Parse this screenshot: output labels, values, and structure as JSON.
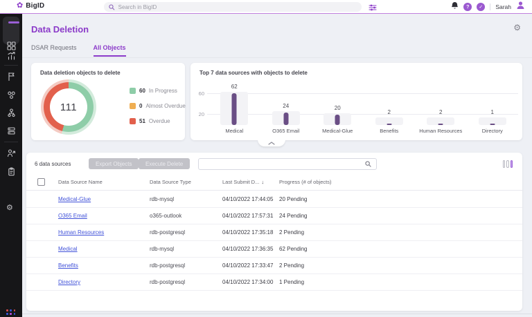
{
  "header": {
    "brand": "BigID",
    "search_placeholder": "Search in BigID",
    "user_name": "Sarah"
  },
  "icons": {
    "logo_flower": "✿",
    "gear": "⚙",
    "help": "?",
    "check": "✓",
    "sort_desc": "↓"
  },
  "page": {
    "title": "Data Deletion",
    "tabs": [
      {
        "label": "DSAR Requests",
        "active": false
      },
      {
        "label": "All Objects",
        "active": true
      }
    ]
  },
  "chart_data": [
    {
      "type": "pie",
      "title": "Data deletion objects to delete",
      "center_total": "111",
      "segments": [
        {
          "label": "In Progress",
          "value": 60,
          "color": "#8ecda8",
          "color_light": "#d3ebdc"
        },
        {
          "label": "Almost Overdue",
          "value": 0,
          "color": "#efae52",
          "color_light": "#f8e0b8"
        },
        {
          "label": "Overdue",
          "value": 51,
          "color": "#e2604c",
          "color_light": "#f4cbc3"
        }
      ],
      "legend_position": "right"
    },
    {
      "type": "bar",
      "title": "Top 7 data sources with objects to delete",
      "categories": [
        "Medical",
        "O365 Email",
        "Medical-Glue",
        "Benefits",
        "Human Resources",
        "Directory"
      ],
      "values": [
        62,
        24,
        20,
        2,
        2,
        1
      ],
      "yticks": [
        "60",
        "20"
      ],
      "ylim": [
        0,
        68
      ],
      "bar_color": "#6a4e85",
      "grid": true,
      "xlabel": "",
      "ylabel": ""
    }
  ],
  "toolbar": {
    "count_label": "6 data sources",
    "export_label": "Export Objects",
    "execute_label": "Execute Delete",
    "search_value": ""
  },
  "table": {
    "columns": [
      "Data Source Name",
      "Data Source Type",
      "Last Submit D...",
      "Progress (# of objects)"
    ],
    "sorted_column": "Last Submit D...",
    "sort_direction": "desc",
    "rows": [
      {
        "name": "Medical-Glue",
        "type": "rdb-mysql",
        "last_submit": "04/10/2022 17:44:05",
        "progress": "20 Pending"
      },
      {
        "name": "O365 Email",
        "type": "o365-outlook",
        "last_submit": "04/10/2022 17:57:31",
        "progress": "24 Pending"
      },
      {
        "name": "Human Resources",
        "type": "rdb-postgresql",
        "last_submit": "04/10/2022 17:35:18",
        "progress": "2 Pending"
      },
      {
        "name": "Medical",
        "type": "rdb-mysql",
        "last_submit": "04/10/2022 17:36:35",
        "progress": "62 Pending"
      },
      {
        "name": "Benefits",
        "type": "rdb-postgresql",
        "last_submit": "04/10/2022 17:33:47",
        "progress": "2 Pending"
      },
      {
        "name": "Directory",
        "type": "rdb-postgresql",
        "last_submit": "04/10/2022 17:34:00",
        "progress": "1 Pending"
      }
    ]
  },
  "colors": {
    "brand_purple": "#8b3ac9",
    "link_blue": "#4152d9",
    "sidebar_bg": "#161618",
    "page_bg": "#eef0f5"
  }
}
